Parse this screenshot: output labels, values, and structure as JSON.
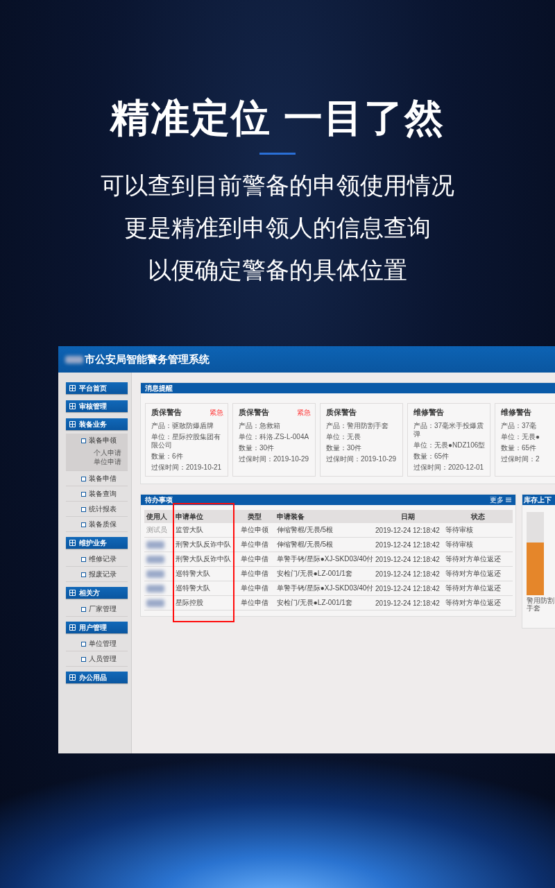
{
  "headline": "精准定位 一目了然",
  "subtitle_lines": [
    "可以查到目前警备的申领使用情况",
    "更是精准到申领人的信息查询",
    "以便确定警备的具体位置"
  ],
  "header": {
    "title": "市公安局智能警务管理系统"
  },
  "sidebar": [
    {
      "label": "平台首页"
    },
    {
      "label": "审核管理"
    },
    {
      "label": "装备业务",
      "children": [
        {
          "label": "装备申领",
          "selected": true,
          "children": [
            {
              "label": "个人申请",
              "selected": false
            },
            {
              "label": "单位申请",
              "selected": false
            }
          ]
        },
        {
          "label": "装备申借",
          "selected": false
        },
        {
          "label": "装备查询",
          "selected": false
        },
        {
          "label": "统计报表",
          "selected": false
        },
        {
          "label": "装备质保",
          "selected": false
        }
      ]
    },
    {
      "label": "维护业务",
      "children": [
        {
          "label": "维修记录",
          "selected": false
        },
        {
          "label": "报废记录",
          "selected": false
        }
      ]
    },
    {
      "label": "相关方",
      "children": [
        {
          "label": "厂家管理",
          "selected": false
        }
      ]
    },
    {
      "label": "用户管理",
      "children": [
        {
          "label": "单位管理",
          "selected": false
        },
        {
          "label": "人员管理",
          "selected": false
        }
      ]
    },
    {
      "label": "办公用品"
    }
  ],
  "messages": {
    "title": "消息提醒",
    "cards": [
      {
        "title": "质保警告",
        "badge": "紧急",
        "lines": [
          "产品：驱散防爆盾牌",
          "单位：星际控股集团有限公司",
          "数量：6件",
          "过保时间：2019-10-21"
        ]
      },
      {
        "title": "质保警告",
        "badge": "紧急",
        "lines": [
          "产品：急救箱",
          "单位：科洛.ZS-L-004A",
          "数量：30件",
          "过保时间：2019-10-29"
        ]
      },
      {
        "title": "质保警告",
        "lines": [
          "产品：警用防割手套",
          "单位：无畏",
          "数量：30件",
          "过保时间：2019-10-29"
        ]
      },
      {
        "title": "维修警告",
        "lines": [
          "产品：37毫米手投爆震弹",
          "单位：无畏●NDZ106型",
          "数量：65件",
          "过保时间：2020-12-01"
        ]
      },
      {
        "title": "维修警告",
        "lines": [
          "产品：37毫",
          "单位：无畏●",
          "数量：65件",
          "过保时间：2"
        ]
      }
    ]
  },
  "todo": {
    "title": "待办事项",
    "more": "更多",
    "columns": [
      "使用人",
      "申请单位",
      "类型",
      "申请装备",
      "日期",
      "状态"
    ],
    "rows": [
      {
        "cells": [
          "测试员",
          "监管大队",
          "单位申领",
          "伸缩警棍/无畏/5根",
          "2019-12-24 12:18:42",
          "等待审核"
        ]
      },
      {
        "cells": [
          "",
          "刑警大队反诈中队",
          "单位申借",
          "伸缩警棍/无畏/5根",
          "2019-12-24 12:18:42",
          "等待审核"
        ]
      },
      {
        "cells": [
          "",
          "刑警大队反诈中队",
          "单位申借",
          "单警手铐/星际●XJ-SKD03/40付",
          "2019-12-24 12:18:42",
          "等待对方单位返还"
        ]
      },
      {
        "cells": [
          "",
          "巡特警大队",
          "单位申借",
          "安检门/无畏●LZ-001/1套",
          "2019-12-24 12:18:42",
          "等待对方单位返还"
        ]
      },
      {
        "cells": [
          "",
          "巡特警大队",
          "单位申借",
          "单警手铐/星际●XJ-SKD03/40付",
          "2019-12-24 12:18:42",
          "等待对方单位返还"
        ]
      },
      {
        "cells": [
          "",
          "星际控股",
          "单位申借",
          "安检门/无畏●LZ-001/1套",
          "2019-12-24 12:18:42",
          "等待对方单位返还"
        ]
      }
    ]
  },
  "stock": {
    "title": "库存上下",
    "bar_label": "警用防割手套"
  }
}
